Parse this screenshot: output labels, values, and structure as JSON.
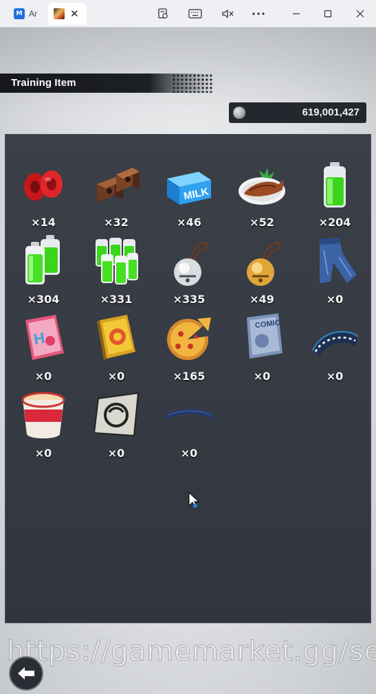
{
  "browser": {
    "tabs": [
      {
        "label": "Ar",
        "icon": "app-logo-icon",
        "active": false
      },
      {
        "label": "",
        "icon": "game-thumbnail-icon",
        "active": true
      }
    ],
    "toolbar_icons": [
      "page-settings-icon",
      "keyboard-icon",
      "mute-icon",
      "more-icon"
    ],
    "window_controls": [
      "minimize-icon",
      "maximize-icon",
      "close-icon"
    ]
  },
  "screen": {
    "title": "Training Item",
    "currency_value": "619,001,427"
  },
  "items": [
    {
      "icon": "red-weights-icon",
      "count": "×14"
    },
    {
      "icon": "brick-blocks-icon",
      "count": "×32"
    },
    {
      "icon": "milk-carton-icon",
      "count": "×46"
    },
    {
      "icon": "fish-dish-icon",
      "count": "×52"
    },
    {
      "icon": "green-battery-icon",
      "count": "×204"
    },
    {
      "icon": "battery-pair-icon",
      "count": "×304"
    },
    {
      "icon": "battery-pack-icon",
      "count": "×331"
    },
    {
      "icon": "silver-bell-icon",
      "count": "×335"
    },
    {
      "icon": "gold-bell-icon",
      "count": "×49"
    },
    {
      "icon": "jeans-icon",
      "count": "×0"
    },
    {
      "icon": "pink-magazine-icon",
      "count": "×0"
    },
    {
      "icon": "yellow-book-icon",
      "count": "×0"
    },
    {
      "icon": "pizza-icon",
      "count": "×165"
    },
    {
      "icon": "comic-book-icon",
      "count": "×0"
    },
    {
      "icon": "striped-band-icon",
      "count": "×0"
    },
    {
      "icon": "cup-noodle-icon",
      "count": "×0"
    },
    {
      "icon": "symbol-card-icon",
      "count": "×0"
    },
    {
      "icon": "blue-headband-icon",
      "count": "×0"
    }
  ],
  "watermark": "https://gamemarket.gg/seller/",
  "colors": {
    "panel": "#363a42",
    "header_band": "#1d2026",
    "currency_box": "#24272d"
  }
}
